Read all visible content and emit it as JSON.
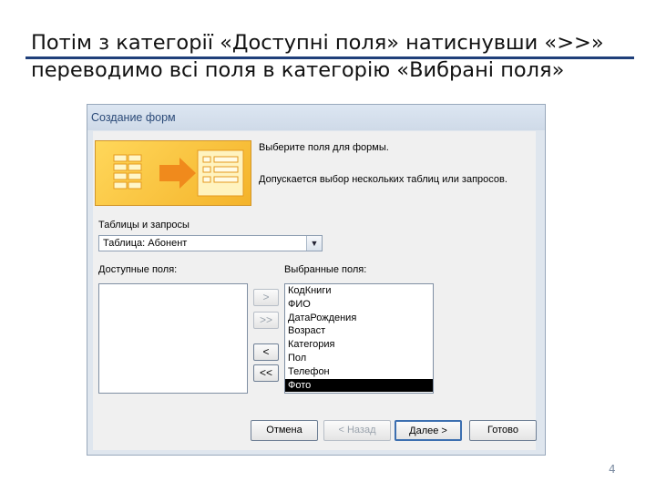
{
  "slide": {
    "line1": "Потім з категорії «Доступні поля» натиснувши «>>»",
    "line2": "переводимо всі поля в категорію «Вибрані поля»",
    "page_number": "4"
  },
  "dialog": {
    "title": "Создание форм",
    "intro_line1": "Выберите поля для формы.",
    "intro_line2": "Допускается выбор нескольких таблиц или запросов.",
    "tables_label": "Таблицы и запросы",
    "tables_value": "Таблица: Абонент",
    "available_label": "Доступные поля:",
    "selected_label": "Выбранные поля:",
    "available_fields": [],
    "selected_fields": [
      "КодКниги",
      "ФИО",
      "ДатаРождения",
      "Возраст",
      "Категория",
      "Пол",
      "Телефон",
      "Фото"
    ],
    "highlighted_field": "Фото",
    "move_buttons": {
      "add_one": ">",
      "add_all": ">>",
      "remove_one": "<",
      "remove_all": "<<"
    },
    "nav_buttons": {
      "cancel": "Отмена",
      "back": "< Назад",
      "next": "Далее >",
      "finish": "Готово"
    }
  },
  "colors": {
    "rule": "#1f3f7a",
    "title_text": "#2b4a78",
    "art_yellow": "#f4b32a"
  }
}
